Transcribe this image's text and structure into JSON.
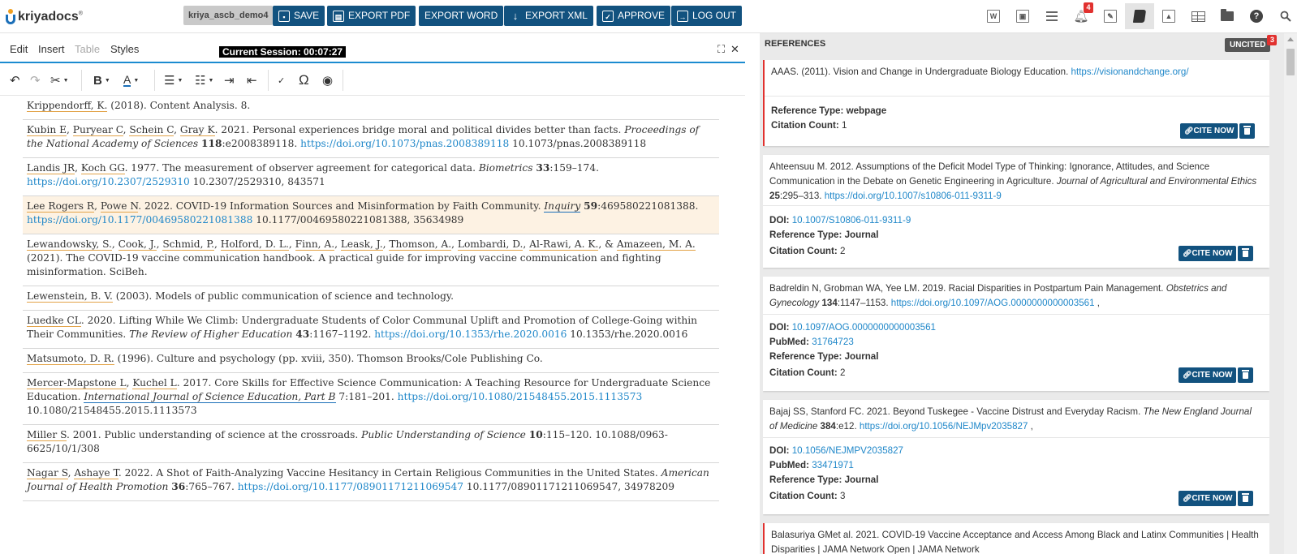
{
  "header": {
    "logo_text": "kriyadocs",
    "logo_reg": "®",
    "project_name": "kriya_ascb_demo4",
    "buttons": {
      "save": "SAVE",
      "export_pdf": "EXPORT PDF",
      "export_word": "EXPORT WORD",
      "export_xml": "EXPORT XML",
      "approve": "APPROVE",
      "logout": "LOG OUT"
    },
    "icons": {
      "word": "W",
      "notification_count": "4",
      "help": "?"
    }
  },
  "editor": {
    "menu": [
      "Edit",
      "Insert",
      "Table",
      "Styles"
    ],
    "session_label": "Current Session: 00:07:27",
    "references": [
      {
        "parts": [
          {
            "t": "au",
            "v": "Krippendorff, K."
          },
          {
            "t": "tx",
            "v": " (2018). Content Analysis. 8."
          }
        ]
      },
      {
        "parts": [
          {
            "t": "au",
            "v": "Kubin E"
          },
          {
            "t": "tx",
            "v": ", "
          },
          {
            "t": "au",
            "v": "Puryear C"
          },
          {
            "t": "tx",
            "v": ", "
          },
          {
            "t": "au",
            "v": "Schein C"
          },
          {
            "t": "tx",
            "v": ", "
          },
          {
            "t": "au",
            "v": "Gray K"
          },
          {
            "t": "tx",
            "v": ". 2021. Personal experiences bridge moral and political divides better than facts. "
          },
          {
            "t": "jn",
            "v": "Proceedings of the National Academy of Sciences"
          },
          {
            "t": "tx",
            "v": " "
          },
          {
            "t": "vol",
            "v": "118"
          },
          {
            "t": "tx",
            "v": ":e2008389118. "
          },
          {
            "t": "lnk",
            "v": "https://doi.org/10.1073/pnas.2008389118"
          },
          {
            "t": "tx",
            "v": " 10.1073/pnas.2008389118"
          }
        ]
      },
      {
        "parts": [
          {
            "t": "au",
            "v": "Landis JR"
          },
          {
            "t": "tx",
            "v": ", "
          },
          {
            "t": "au",
            "v": "Koch GG"
          },
          {
            "t": "tx",
            "v": ". 1977. The measurement of observer agreement for categorical data. "
          },
          {
            "t": "jn",
            "v": "Biometrics"
          },
          {
            "t": "tx",
            "v": " "
          },
          {
            "t": "vol",
            "v": "33"
          },
          {
            "t": "tx",
            "v": ":159–174. "
          },
          {
            "t": "lnk",
            "v": "https://doi.org/10.2307/2529310"
          },
          {
            "t": "tx",
            "v": " 10.2307/2529310, 843571"
          }
        ]
      },
      {
        "highlight": true,
        "parts": [
          {
            "t": "au",
            "v": "Lee Rogers R"
          },
          {
            "t": "tx",
            "v": ", "
          },
          {
            "t": "au",
            "v": "Powe N"
          },
          {
            "t": "tx",
            "v": ". 2022. COVID-19 Information Sources and Misinformation by Faith Community. "
          },
          {
            "t": "jnul",
            "v": "Inquiry"
          },
          {
            "t": "tx",
            "v": " "
          },
          {
            "t": "vol",
            "v": "59"
          },
          {
            "t": "tx",
            "v": ":469580221081388. "
          },
          {
            "t": "lnk",
            "v": "https://doi.org/10.1177/00469580221081388"
          },
          {
            "t": "tx",
            "v": " 10.1177/00469580221081388, 35634989"
          }
        ]
      },
      {
        "parts": [
          {
            "t": "au",
            "v": "Lewandowsky, S."
          },
          {
            "t": "tx",
            "v": ", "
          },
          {
            "t": "au",
            "v": "Cook, J."
          },
          {
            "t": "tx",
            "v": ", "
          },
          {
            "t": "au",
            "v": "Schmid, P."
          },
          {
            "t": "tx",
            "v": ", "
          },
          {
            "t": "au",
            "v": "Holford, D. L."
          },
          {
            "t": "tx",
            "v": ", "
          },
          {
            "t": "au",
            "v": "Finn, A."
          },
          {
            "t": "tx",
            "v": ", "
          },
          {
            "t": "au",
            "v": "Leask, J."
          },
          {
            "t": "tx",
            "v": ", "
          },
          {
            "t": "au",
            "v": "Thomson, A."
          },
          {
            "t": "tx",
            "v": ", "
          },
          {
            "t": "au",
            "v": "Lombardi, D."
          },
          {
            "t": "tx",
            "v": ", "
          },
          {
            "t": "au",
            "v": "Al-Rawi, A. K."
          },
          {
            "t": "tx",
            "v": ", & "
          },
          {
            "t": "au",
            "v": "Amazeen, M. A."
          },
          {
            "t": "tx",
            "v": " (2021). The COVID-19 vaccine communication handbook. A practical guide for improving vaccine communication and fighting misinformation. SciBeh."
          }
        ]
      },
      {
        "parts": [
          {
            "t": "au",
            "v": "Lewenstein, B. V."
          },
          {
            "t": "tx",
            "v": " (2003). Models of public communication of science and technology."
          }
        ]
      },
      {
        "parts": [
          {
            "t": "au",
            "v": "Luedke CL"
          },
          {
            "t": "tx",
            "v": ". 2020. Lifting While We Climb: Undergraduate Students of Color Communal Uplift and Promotion of College-Going within Their Communities. "
          },
          {
            "t": "jn",
            "v": "The Review of Higher Education"
          },
          {
            "t": "tx",
            "v": " "
          },
          {
            "t": "vol",
            "v": "43"
          },
          {
            "t": "tx",
            "v": ":1167–1192. "
          },
          {
            "t": "lnk",
            "v": "https://doi.org/10.1353/rhe.2020.0016"
          },
          {
            "t": "tx",
            "v": " 10.1353/rhe.2020.0016"
          }
        ]
      },
      {
        "parts": [
          {
            "t": "au",
            "v": "Matsumoto, D. R."
          },
          {
            "t": "tx",
            "v": " (1996). Culture and psychology (pp. xviii, 350). Thomson Brooks/Cole Publishing Co."
          }
        ]
      },
      {
        "parts": [
          {
            "t": "au",
            "v": "Mercer-Mapstone L"
          },
          {
            "t": "tx",
            "v": ", "
          },
          {
            "t": "au",
            "v": "Kuchel L"
          },
          {
            "t": "tx",
            "v": ". 2017. Core Skills for Effective Science Communication: A Teaching Resource for Undergraduate Science Education. "
          },
          {
            "t": "jnul",
            "v": "International Journal of Science Education, Part B"
          },
          {
            "t": "tx",
            "v": " 7:181–201. "
          },
          {
            "t": "lnk",
            "v": "https://doi.org/10.1080/21548455.2015.1113573"
          },
          {
            "t": "tx",
            "v": " 10.1080/21548455.2015.1113573"
          }
        ]
      },
      {
        "parts": [
          {
            "t": "au",
            "v": "Miller S"
          },
          {
            "t": "tx",
            "v": ". 2001. Public understanding of science at the crossroads. "
          },
          {
            "t": "jn",
            "v": "Public Understanding of Science"
          },
          {
            "t": "tx",
            "v": " "
          },
          {
            "t": "vol",
            "v": "10"
          },
          {
            "t": "tx",
            "v": ":115–120. 10.1088/0963-6625/10/1/308"
          }
        ]
      },
      {
        "parts": [
          {
            "t": "au",
            "v": "Nagar S"
          },
          {
            "t": "tx",
            "v": ", "
          },
          {
            "t": "au",
            "v": "Ashaye T"
          },
          {
            "t": "tx",
            "v": ". 2022. A Shot of Faith-Analyzing Vaccine Hesitancy in Certain Religious Communities in the United States. "
          },
          {
            "t": "jn",
            "v": "American Journal of Health Promotion"
          },
          {
            "t": "tx",
            "v": " "
          },
          {
            "t": "vol",
            "v": "36"
          },
          {
            "t": "tx",
            "v": ":765–767. "
          },
          {
            "t": "lnk",
            "v": "https://doi.org/10.1177/08901171211069547"
          },
          {
            "t": "tx",
            "v": " 10.1177/08901171211069547, 34978209"
          }
        ]
      }
    ]
  },
  "panel": {
    "title": "REFERENCES",
    "uncited_label": "UNCITED",
    "uncited_count": "3",
    "cite_now_label": "CITE NOW",
    "doi_label": "DOI:",
    "pubmed_label": "PubMed:",
    "type_label": "Reference Type:",
    "count_label": "Citation Count:",
    "cards": [
      {
        "uncited": true,
        "citation": [
          {
            "t": "tx",
            "v": "AAAS. (2011). Vision and Change in Undergraduate Biology Education. "
          },
          {
            "t": "lnk",
            "v": "https://visionandchange.org/"
          }
        ],
        "doi": "",
        "pubmed": "",
        "type": "webpage",
        "count": "1"
      },
      {
        "uncited": false,
        "citation": [
          {
            "t": "tx",
            "v": "Ahteensuu M. 2012. Assumptions of the Deficit Model Type of Thinking: Ignorance, Attitudes, and Science Communication in the Debate on Genetic Engineering in Agriculture. "
          },
          {
            "t": "jn",
            "v": "Journal of Agricultural and Environmental Ethics"
          },
          {
            "t": "tx",
            "v": " "
          },
          {
            "t": "vol",
            "v": "25"
          },
          {
            "t": "tx",
            "v": ":295–313. "
          },
          {
            "t": "lnk",
            "v": "https://doi.org/10.1007/s10806-011-9311-9"
          }
        ],
        "doi": "10.1007/S10806-011-9311-9",
        "pubmed": "",
        "type": "Journal",
        "count": "2"
      },
      {
        "uncited": false,
        "citation": [
          {
            "t": "tx",
            "v": "Badreldin N, Grobman WA, Yee LM. 2019. Racial Disparities in Postpartum Pain Management. "
          },
          {
            "t": "jn",
            "v": "Obstetrics and Gynecology"
          },
          {
            "t": "tx",
            "v": " "
          },
          {
            "t": "vol",
            "v": "134"
          },
          {
            "t": "tx",
            "v": ":1147–1153. "
          },
          {
            "t": "lnk",
            "v": "https://doi.org/10.1097/AOG.0000000000003561"
          },
          {
            "t": "tx",
            "v": " ,"
          }
        ],
        "doi": "10.1097/AOG.0000000000003561",
        "pubmed": "31764723",
        "type": "Journal",
        "count": "2"
      },
      {
        "uncited": false,
        "citation": [
          {
            "t": "tx",
            "v": "Bajaj SS, Stanford FC. 2021. Beyond Tuskegee - Vaccine Distrust and Everyday Racism. "
          },
          {
            "t": "jn",
            "v": "The New England Journal of Medicine"
          },
          {
            "t": "tx",
            "v": " "
          },
          {
            "t": "vol",
            "v": "384"
          },
          {
            "t": "tx",
            "v": ":e12. "
          },
          {
            "t": "lnk",
            "v": "https://doi.org/10.1056/NEJMpv2035827"
          },
          {
            "t": "tx",
            "v": " ,"
          }
        ],
        "doi": "10.1056/NEJMPV2035827",
        "pubmed": "33471971",
        "type": "Journal",
        "count": "3"
      },
      {
        "uncited": true,
        "citation": [
          {
            "t": "tx",
            "v": "Balasuriya GMet al. 2021. COVID-19 Vaccine Acceptance and Access Among Black and Latinx Communities | Health Disparities | JAMA Network Open | JAMA Network"
          }
        ],
        "doi": "",
        "pubmed": "",
        "type": "",
        "count": ""
      }
    ]
  }
}
